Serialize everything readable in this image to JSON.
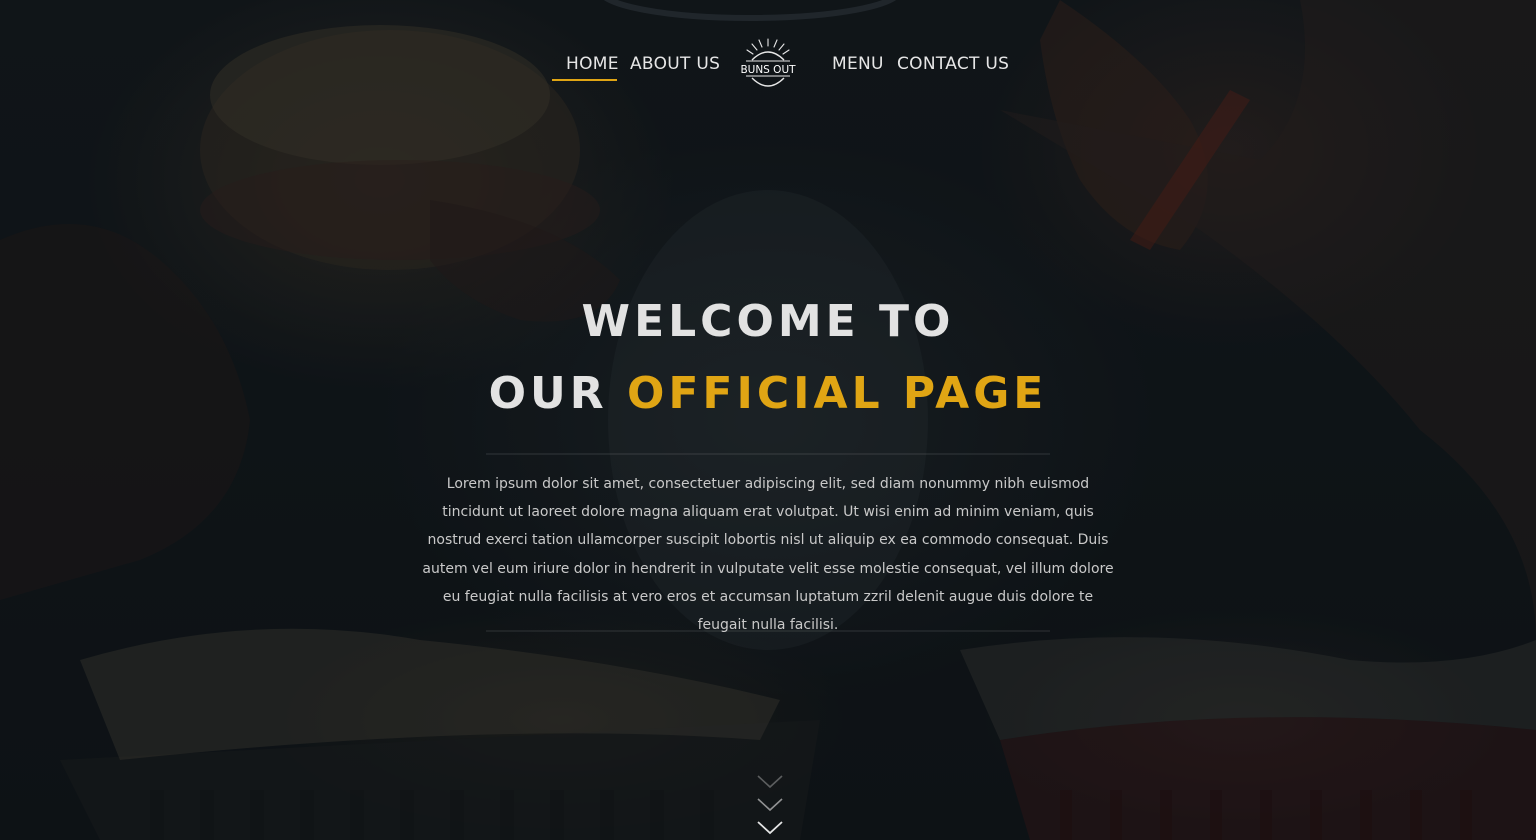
{
  "nav": {
    "items": [
      {
        "label": "HOME",
        "active": true
      },
      {
        "label": "ABOUT US",
        "active": false
      },
      {
        "label": "MENU",
        "active": false
      },
      {
        "label": "CONTACT US",
        "active": false
      }
    ],
    "logo": {
      "text": "BUNS OUT",
      "icon": "sunburst-logo-icon"
    }
  },
  "hero": {
    "title_line1": "WELCOME TO",
    "title_line2_plain": "OUR ",
    "title_line2_accent": "OFFICIAL PAGE",
    "body": "Lorem ipsum dolor sit amet, consectetuer adipiscing elit, sed diam nonummy nibh euismod tincidunt ut laoreet dolore magna aliquam erat volutpat. Ut wisi enim ad minim veniam, quis nostrud exerci tation ullamcorper suscipit lobortis nisl ut aliquip ex ea commodo consequat. Duis autem vel eum iriure dolor in hendrerit in vulputate velit esse molestie consequat, vel illum dolore eu feugiat nulla facilisis at vero eros et accumsan luptatum zzril delenit augue duis dolore te feugait nulla facilisi.",
    "scroll_icon": "chevron-down-triple-icon"
  },
  "colors": {
    "accent": "#e0a514",
    "text": "#e2e2e2",
    "background": "#12171b"
  }
}
